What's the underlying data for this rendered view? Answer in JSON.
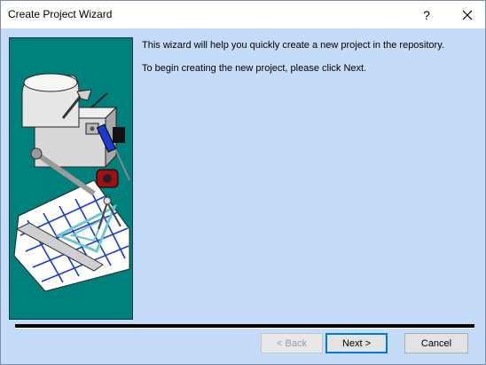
{
  "window": {
    "title": "Create Project Wizard",
    "help_label": "?"
  },
  "content": {
    "intro": "This wizard will help you quickly create a new project in the repository.",
    "instruction": "To begin creating the new project, please click Next."
  },
  "buttons": {
    "back": "< Back",
    "next": "Next >",
    "cancel": "Cancel"
  },
  "icons": {
    "close": "close-icon",
    "illustration": "toolbox-blueprint-illustration"
  },
  "colors": {
    "dialog_background": "#c5dcf9",
    "image_panel_background": "#00807c",
    "default_button_border": "#0078d7"
  },
  "state": {
    "back_enabled": false,
    "default_button": "next"
  }
}
